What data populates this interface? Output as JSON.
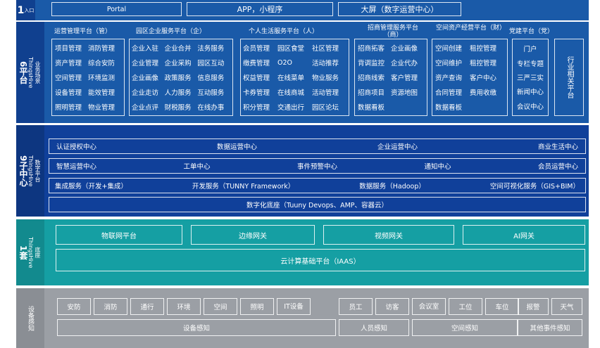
{
  "row1": {
    "label_big": "1",
    "label_small": "入口",
    "entries": [
      "Portal",
      "APP，小程序",
      "大屏（数字运营中心）"
    ]
  },
  "row2": {
    "label_big": "6平台",
    "label_brand": "ThingsHive",
    "label_small": "业务场景",
    "platforms": [
      {
        "title": "运营管理平台（管）",
        "items": [
          "项目管理",
          "消防管理",
          "资产管理",
          "综合安防",
          "空间管理",
          "环境监测",
          "设备管理",
          "能效管理",
          "照明管理",
          "物业管理"
        ]
      },
      {
        "title": "园区企业服务平台（企）",
        "items": [
          "企业入驻",
          "企业合并",
          "法务服务",
          "企业管理",
          "企业采购",
          "园区互动",
          "企业画像",
          "政策服务",
          "信息服务",
          "企业走访",
          "人力服务",
          "互动服务",
          "企业点评",
          "财税服务",
          "在线办事"
        ]
      },
      {
        "title": "个人生活服务平台（人）",
        "items": [
          "会员管理",
          "园区食堂",
          "社区管理",
          "缴费管理",
          "O2O",
          "活动推荐",
          "权益管理",
          "在线菜单",
          "物业服务",
          "卡券管理",
          "在线商城",
          "活动管理",
          "积分管理",
          "交通出行",
          "园区论坛"
        ]
      },
      {
        "title": "招商管理服务平台（商）",
        "items": [
          "招商拓客",
          "企业画像",
          "背调监控",
          "企业代办",
          "招商线索",
          "客户管理",
          "招商项目",
          "资源地图",
          "数据看板"
        ]
      },
      {
        "title": "空间资产经营平台（财）",
        "items": [
          "空间创建",
          "租控管理",
          "空间维护",
          "租控管理",
          "资产查询",
          "客户中心",
          "合同管理",
          "费用收缴",
          "数据看板"
        ]
      },
      {
        "title": "党建平台（党）",
        "items": [
          "门户",
          "专栏专题",
          "三严三实",
          "新闻中心",
          "会议中心"
        ]
      }
    ],
    "industry": "行业相关平台"
  },
  "row3": {
    "label_big": "9子中心",
    "label_brand": "ThingsHive",
    "label_small": "数字平台",
    "centers_a": [
      "认证授权中心",
      "数据运营中心",
      "企业运营中心",
      "商业生活中心"
    ],
    "centers_b": [
      "智慧运营中心",
      "工单中心",
      "事件预警中心",
      "通知中心",
      "会员运营中心"
    ],
    "services": [
      "集成服务（开发+集成）",
      "开发服务（TUNNY Framework）",
      "数据服务（Hadoop）",
      "空间可视化服务（GIS+BIM）"
    ],
    "base": "数字化底座（Tuuny Devops、AMP、容器云）"
  },
  "row4": {
    "label_big": "1套",
    "label_brand": "ThingsHive",
    "label_small": "底座",
    "gateways": [
      "物联网平台",
      "边缘网关",
      "视频网关",
      "AI网关"
    ],
    "cloud": "云计算基础平台（IAAS）"
  },
  "row5": {
    "label": "设备感知",
    "devices": [
      "安防",
      "消防",
      "通行",
      "环境",
      "空间",
      "照明",
      "IT设备",
      "员工",
      "访客",
      "会议室",
      "工位",
      "车位",
      "报警",
      "天气"
    ],
    "groups": [
      "设备感知",
      "人员感知",
      "空间感知",
      "其他事件感知"
    ]
  },
  "colors": {
    "dark_blue": "#10419a",
    "mid_blue": "#1a5fb4",
    "teal": "#139ea3",
    "gray": "#9a9ea4",
    "border": "#ffffff"
  }
}
